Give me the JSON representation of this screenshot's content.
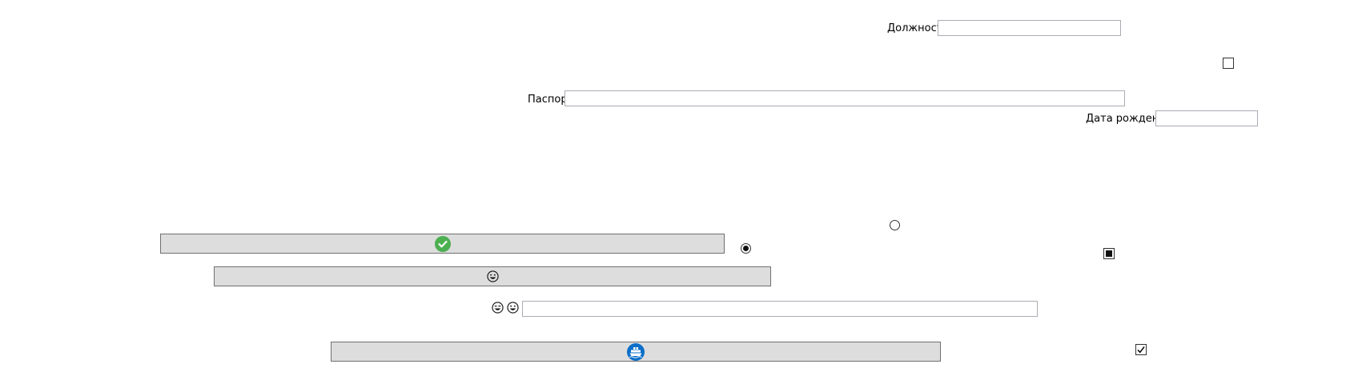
{
  "form": {
    "position_label": "Должность",
    "position_value": "",
    "passport_label": "Паспорт",
    "passport_value": "",
    "birthdate_label": "Дата рождения",
    "birthdate_value": "",
    "text_value": ""
  },
  "checkboxes": {
    "top_checked": false,
    "tristate": "indeterminate",
    "bottom_checked": true
  },
  "radios": {
    "upper_selected": false,
    "lower_selected": true
  },
  "buttons": {
    "first_icon": "check-circle-icon",
    "second_icon": "grinning-face-icon",
    "third_icon": "ship-icon"
  },
  "emoji_icons": [
    "smiling-face-icon",
    "grinning-face-icon"
  ],
  "colors": {
    "check_green": "#4caf50",
    "ship_blue": "#0b6fc9",
    "button_bg": "#dddddd"
  }
}
